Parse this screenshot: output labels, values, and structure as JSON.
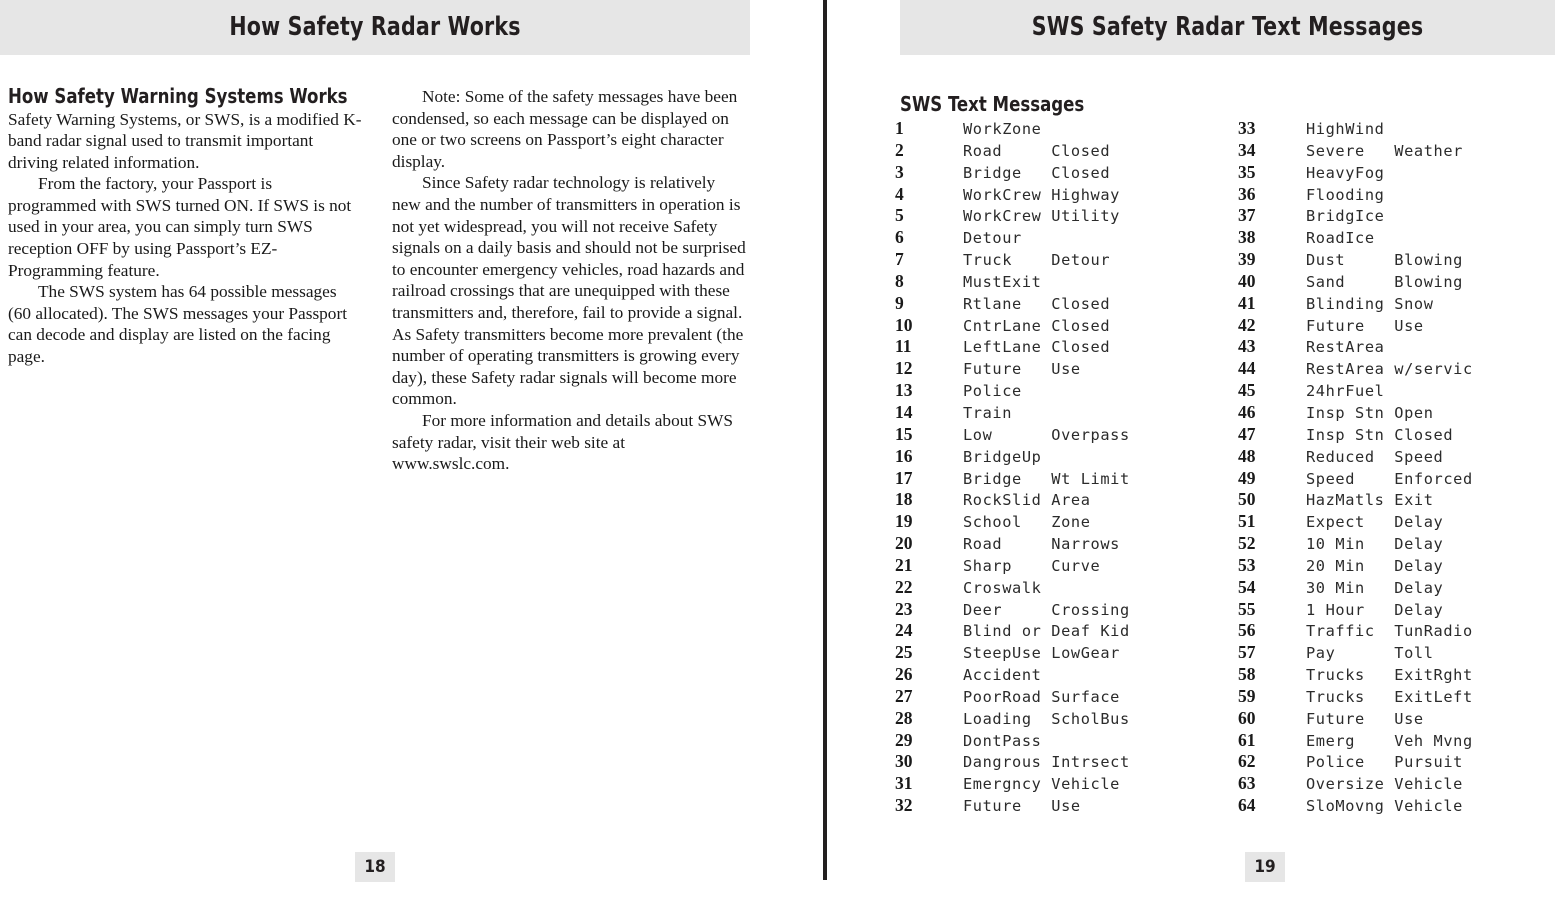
{
  "left_page": {
    "running_head": "How Safety Radar Works",
    "folio": "18",
    "column_one": {
      "heading": "How Safety Warning Systems Works",
      "paragraphs": [
        "Safety Warning Systems, or SWS, is a modified K-band radar signal used to transmit important driving related information.",
        "From the factory, your Passport is programmed with SWS turned ON. If SWS is not used in your area, you can simply turn SWS reception OFF by using Passport’s EZ-Programming feature.",
        "The SWS system has 64 possible messages (60 allocated). The SWS messages your Passport can decode and display are listed on the facing page."
      ]
    },
    "column_two": {
      "paragraphs": [
        "Note: Some of the safety messages have been condensed, so each message can be displayed on one or two screens on Passport’s eight character display.",
        "Since Safety radar technology is relatively new and the number of transmitters in operation is not yet widespread, you will not receive Safety signals on a daily basis and should not be surprised to encounter emergency vehicles, road hazards and railroad crossings that are unequipped with these transmitters and, therefore, fail to provide a signal. As Safety transmitters become more prevalent (the number of operating transmitters is growing every day), these Safety radar signals will become more common.",
        "For more information and details about SWS safety radar, visit their web site at www.swslc.com."
      ]
    }
  },
  "right_page": {
    "running_head": "SWS Safety Radar Text Messages",
    "folio": "19",
    "list_heading": "SWS Text Messages",
    "messages_left": [
      {
        "num": "1",
        "text": "WorkZone"
      },
      {
        "num": "2",
        "text": "Road     Closed"
      },
      {
        "num": "3",
        "text": "Bridge   Closed"
      },
      {
        "num": "4",
        "text": "WorkCrew Highway"
      },
      {
        "num": "5",
        "text": "WorkCrew Utility"
      },
      {
        "num": "6",
        "text": "Detour"
      },
      {
        "num": "7",
        "text": "Truck    Detour"
      },
      {
        "num": "8",
        "text": "MustExit"
      },
      {
        "num": "9",
        "text": "Rtlane   Closed"
      },
      {
        "num": "10",
        "text": "CntrLane Closed"
      },
      {
        "num": "11",
        "text": "LeftLane Closed"
      },
      {
        "num": "12",
        "text": "Future   Use"
      },
      {
        "num": "13",
        "text": "Police"
      },
      {
        "num": "14",
        "text": "Train"
      },
      {
        "num": "15",
        "text": "Low      Overpass"
      },
      {
        "num": "16",
        "text": "BridgeUp"
      },
      {
        "num": "17",
        "text": "Bridge   Wt Limit"
      },
      {
        "num": "18",
        "text": "RockSlid Area"
      },
      {
        "num": "19",
        "text": "School   Zone"
      },
      {
        "num": "20",
        "text": "Road     Narrows"
      },
      {
        "num": "21",
        "text": "Sharp    Curve"
      },
      {
        "num": "22",
        "text": "Croswalk"
      },
      {
        "num": "23",
        "text": "Deer     Crossing"
      },
      {
        "num": "24",
        "text": "Blind or Deaf Kid"
      },
      {
        "num": "25",
        "text": "SteepUse LowGear"
      },
      {
        "num": "26",
        "text": "Accident"
      },
      {
        "num": "27",
        "text": "PoorRoad Surface"
      },
      {
        "num": "28",
        "text": "Loading  ScholBus"
      },
      {
        "num": "29",
        "text": "DontPass"
      },
      {
        "num": "30",
        "text": "Dangrous Intrsect"
      },
      {
        "num": "31",
        "text": "Emergncy Vehicle"
      },
      {
        "num": "32",
        "text": "Future   Use"
      }
    ],
    "messages_right": [
      {
        "num": "33",
        "text": "HighWind"
      },
      {
        "num": "34",
        "text": "Severe   Weather"
      },
      {
        "num": "35",
        "text": "HeavyFog"
      },
      {
        "num": "36",
        "text": "Flooding"
      },
      {
        "num": "37",
        "text": "BridgIce"
      },
      {
        "num": "38",
        "text": "RoadIce"
      },
      {
        "num": "39",
        "text": "Dust     Blowing"
      },
      {
        "num": "40",
        "text": "Sand     Blowing"
      },
      {
        "num": "41",
        "text": "Blinding Snow"
      },
      {
        "num": "42",
        "text": "Future   Use"
      },
      {
        "num": "43",
        "text": "RestArea"
      },
      {
        "num": "44",
        "text": "RestArea w/servic"
      },
      {
        "num": "45",
        "text": "24hrFuel"
      },
      {
        "num": "46",
        "text": "Insp Stn Open"
      },
      {
        "num": "47",
        "text": "Insp Stn Closed"
      },
      {
        "num": "48",
        "text": "Reduced  Speed"
      },
      {
        "num": "49",
        "text": "Speed    Enforced"
      },
      {
        "num": "50",
        "text": "HazMatls Exit"
      },
      {
        "num": "51",
        "text": "Expect   Delay"
      },
      {
        "num": "52",
        "text": "10 Min   Delay"
      },
      {
        "num": "53",
        "text": "20 Min   Delay"
      },
      {
        "num": "54",
        "text": "30 Min   Delay"
      },
      {
        "num": "55",
        "text": "1 Hour   Delay"
      },
      {
        "num": "56",
        "text": "Traffic  TunRadio"
      },
      {
        "num": "57",
        "text": "Pay      Toll"
      },
      {
        "num": "58",
        "text": "Trucks   ExitRght"
      },
      {
        "num": "59",
        "text": "Trucks   ExitLeft"
      },
      {
        "num": "60",
        "text": "Future   Use"
      },
      {
        "num": "61",
        "text": "Emerg    Veh Mvng"
      },
      {
        "num": "62",
        "text": "Police   Pursuit"
      },
      {
        "num": "63",
        "text": "Oversize Vehicle"
      },
      {
        "num": "64",
        "text": "SloMovng Vehicle"
      }
    ]
  },
  "colors": {
    "band": "#e6e6e6",
    "ink": "#231f20",
    "body_text": "#1a1a1a",
    "paper": "#ffffff"
  }
}
